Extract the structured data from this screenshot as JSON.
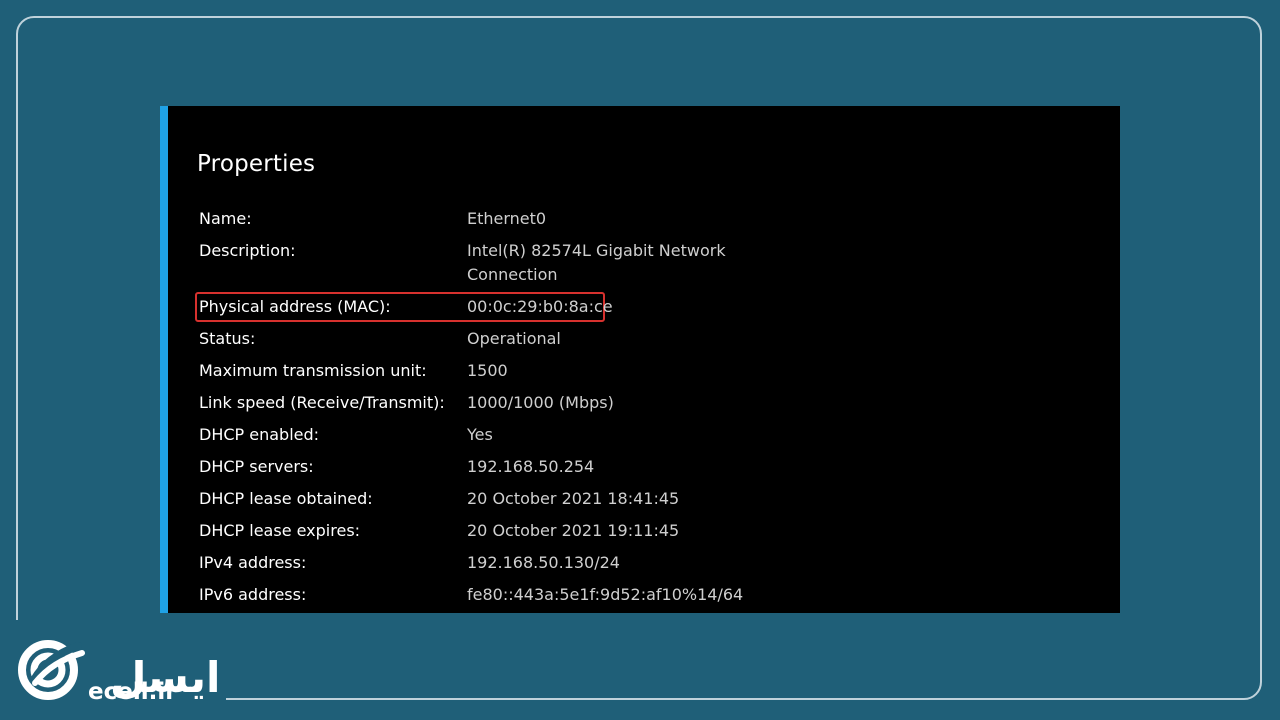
{
  "panel": {
    "title": "Properties"
  },
  "properties": [
    {
      "label": "Name:",
      "value": "Ethernet0"
    },
    {
      "label": "Description:",
      "value": "Intel(R) 82574L Gigabit Network Connection"
    },
    {
      "label": "Physical address (MAC):",
      "value": "00:0c:29:b0:8a:ce"
    },
    {
      "label": "Status:",
      "value": "Operational"
    },
    {
      "label": "Maximum transmission unit:",
      "value": "1500"
    },
    {
      "label": "Link speed (Receive/Transmit):",
      "value": "1000/1000 (Mbps)"
    },
    {
      "label": "DHCP enabled:",
      "value": "Yes"
    },
    {
      "label": "DHCP servers:",
      "value": "192.168.50.254"
    },
    {
      "label": "DHCP lease obtained:",
      "value": "20 October 2021 18:41:45"
    },
    {
      "label": "DHCP lease expires:",
      "value": "20 October 2021 19:11:45"
    },
    {
      "label": "IPv4 address:",
      "value": "192.168.50.130/24"
    },
    {
      "label": "IPv6 address:",
      "value": "fe80::443a:5e1f:9d52:af10%14/64"
    }
  ],
  "logo": {
    "name": "ایسل",
    "domain": "ecell.ir",
    "icon": "ecell-logo-icon"
  },
  "colors": {
    "background": "#1f5f78",
    "panel": "#000000",
    "accent": "#1fa2e6",
    "highlight": "#d7312e",
    "label": "#ffffff",
    "value": "#cfcfcf"
  }
}
